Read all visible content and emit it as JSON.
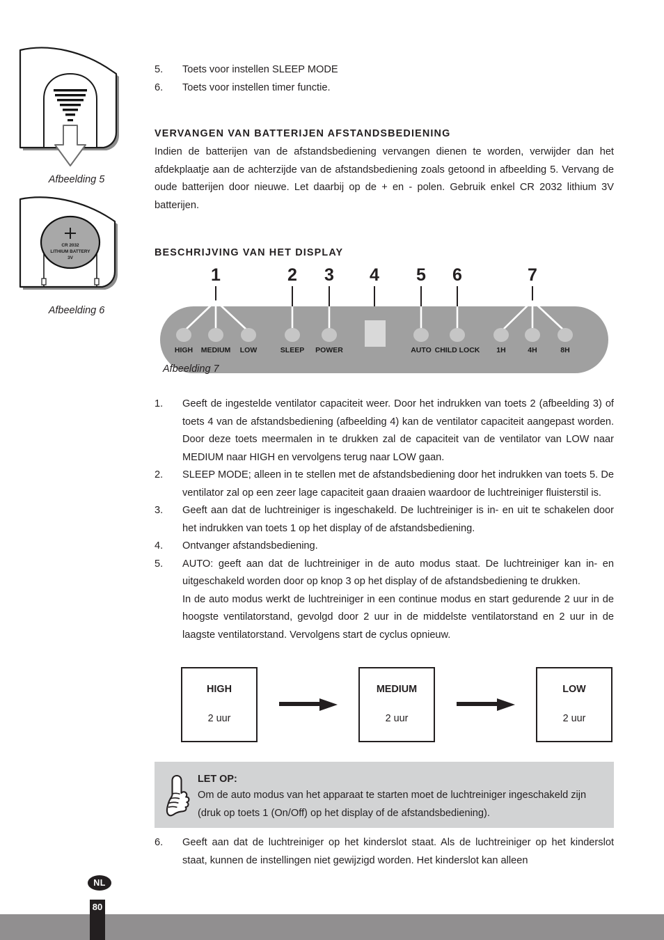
{
  "page": {
    "language_badge": "NL",
    "page_number": "80"
  },
  "figures": {
    "fig5": {
      "caption": "Afbeelding 5",
      "alt_name": "remote-back-cover-removal"
    },
    "fig6": {
      "caption": "Afbeelding 6",
      "alt_name": "remote-battery-compartment",
      "battery_line1": "CR 2032",
      "battery_line2": "LITHIUM BATTERY",
      "battery_line3": "3V",
      "polarity": "+"
    },
    "fig7": {
      "caption": "Afbeelding 7",
      "alt_name": "display-panel-diagram",
      "callout_numbers": [
        "1",
        "2",
        "3",
        "4",
        "5",
        "6",
        "7"
      ],
      "led_labels": [
        "HIGH",
        "MEDIUM",
        "LOW",
        "SLEEP",
        "POWER",
        "AUTO",
        "CHILD LOCK",
        "1H",
        "4H",
        "8H"
      ],
      "panel_color": "#a0a0a0",
      "led_color": "#c6c6c6",
      "receiver_color": "#d9d9d9"
    }
  },
  "top_list": [
    {
      "num": "5.",
      "text": "Toets voor instellen SLEEP MODE"
    },
    {
      "num": "6.",
      "text": "Toets voor instellen timer functie."
    }
  ],
  "battery_section": {
    "heading": "VERVANGEN VAN BATTERIJEN AFSTANDSBEDIENING",
    "body": "Indien de batterijen van de afstandsbediening vervangen dienen te worden, verwijder dan het afdekplaatje aan de achterzijde van de afstandsbediening zoals getoond in afbeelding 5. Vervang de oude batterijen door nieuwe. Let daarbij op de + en - polen. Gebruik enkel CR 2032 lithium 3V batterijen."
  },
  "display_section": {
    "heading": "BESCHRIJVING VAN HET DISPLAY"
  },
  "display_items": [
    {
      "num": "1.",
      "text": "Geeft de ingestelde ventilator capaciteit weer. Door het indrukken van toets 2 (afbeelding 3) of toets 4 van de afstandsbediening (afbeelding 4)  kan de ventilator capaciteit aangepast worden. Door deze toets meermalen in te drukken zal de capaciteit van de ventilator van LOW naar MEDIUM  naar HIGH en vervolgens terug naar LOW gaan."
    },
    {
      "num": "2.",
      "text": "SLEEP MODE;  alleen in te stellen met de afstandsbediening door het indrukken van toets 5. De ventilator zal op een zeer lage capaciteit gaan draaien waardoor de luchtreiniger fluisterstil is."
    },
    {
      "num": "3.",
      "text": "Geeft aan dat de luchtreiniger is ingeschakeld. De luchtreiniger is in- en uit te schakelen door het indrukken van toets 1 op het display of de afstandsbediening."
    },
    {
      "num": "4.",
      "text": "Ontvanger afstandsbediening."
    },
    {
      "num": "5.",
      "text": "AUTO: geeft aan dat de luchtreiniger in de auto modus staat. De luchtreiniger kan in- en uitgeschakeld worden door op knop 3 op het display of de afstandsbediening te drukken."
    }
  ],
  "auto_mode_paragraph": "In de auto modus werkt de luchtreiniger in een continue modus en start gedurende 2 uur in de hoogste ventilatorstand, gevolgd door 2 uur in de middelste ventilatorstand en 2 uur in de laagste ventilatorstand. Vervolgens start de cyclus opnieuw.",
  "flow_diagram": {
    "steps": [
      {
        "label": "HIGH",
        "duration": "2 uur"
      },
      {
        "label": "MEDIUM",
        "duration": "2 uur"
      },
      {
        "label": "LOW",
        "duration": "2 uur"
      }
    ]
  },
  "note": {
    "title": "LET OP:",
    "body": "Om de auto modus van het apparaat te starten moet de luchtreiniger ingeschakeld zijn (druk op toets 1 (On/Off) op het display of de afstandsbediening).",
    "icon": "pointing-hand-icon",
    "background": "#d2d3d4"
  },
  "tail_list": [
    {
      "num": "6.",
      "text": "Geeft aan dat de luchtreiniger op het kinderslot staat. Als de luchtreiniger op het kinderslot staat, kunnen de instellingen niet gewijzigd worden. Het kinderslot kan alleen"
    }
  ]
}
